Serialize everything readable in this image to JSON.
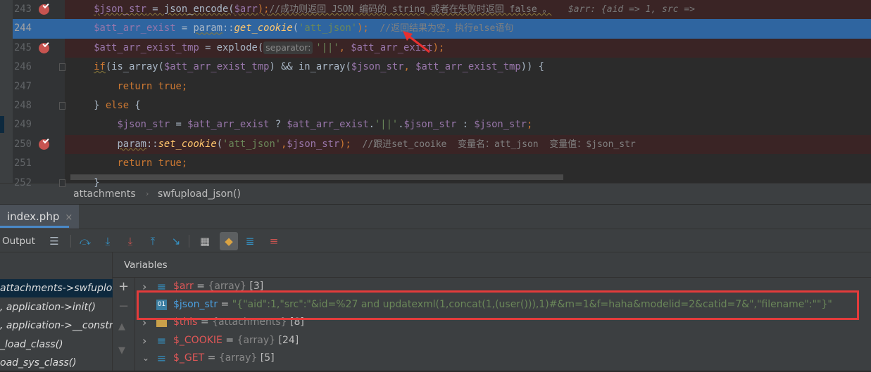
{
  "editor": {
    "lines": [
      {
        "num": "243",
        "bp": true,
        "fold": false,
        "state": "bp",
        "tokens": [
          [
            "    ",
            "d"
          ],
          [
            "$json_str",
            "v"
          ],
          [
            " = json_encode(",
            "d"
          ],
          [
            "$arr",
            "v"
          ],
          [
            ");",
            "p"
          ],
          [
            "//成功则返回 JSON 编码的 string 或者在失败时返回 false 。",
            "c"
          ],
          [
            "   $arr: {aid => 1, src =>",
            "hint"
          ]
        ]
      },
      {
        "num": "244",
        "bp": false,
        "fold": false,
        "state": "cur",
        "tokens": [
          [
            "    ",
            "d"
          ],
          [
            "$att_arr_exist",
            "v"
          ],
          [
            " = ",
            "d"
          ],
          [
            "param",
            "d"
          ],
          [
            "::",
            "d"
          ],
          [
            "get_cookie",
            "f"
          ],
          [
            "(",
            "d"
          ],
          [
            "'att_json'",
            "s"
          ],
          [
            ");",
            "p"
          ],
          [
            "  //返回结果为空，执行else语句",
            "c"
          ]
        ]
      },
      {
        "num": "245",
        "bp": true,
        "fold": false,
        "state": "bp",
        "tokens": [
          [
            "    ",
            "d"
          ],
          [
            "$att_arr_exist_tmp",
            "v"
          ],
          [
            " = explode(",
            "d"
          ],
          [
            "separator:",
            "param"
          ],
          [
            "'||'",
            "s"
          ],
          [
            ", ",
            "p"
          ],
          [
            "$att_arr_exist",
            "v"
          ],
          [
            ");",
            "p"
          ]
        ]
      },
      {
        "num": "246",
        "bp": false,
        "fold": true,
        "state": "",
        "tokens": [
          [
            "    ",
            "d"
          ],
          [
            "if",
            "k"
          ],
          [
            "(is_array(",
            "d"
          ],
          [
            "$att_arr_exist_tmp",
            "v"
          ],
          [
            ") && in_array(",
            "d"
          ],
          [
            "$json_str",
            "v"
          ],
          [
            ", ",
            "p"
          ],
          [
            "$att_arr_exist_tmp",
            "v"
          ],
          [
            ")) {",
            "d"
          ]
        ]
      },
      {
        "num": "247",
        "bp": false,
        "fold": false,
        "state": "",
        "tokens": [
          [
            "        ",
            "d"
          ],
          [
            "return true;",
            "k"
          ]
        ]
      },
      {
        "num": "248",
        "bp": false,
        "fold": true,
        "state": "",
        "tokens": [
          [
            "    ",
            "d"
          ],
          [
            "} ",
            "d"
          ],
          [
            "else",
            "k"
          ],
          [
            " {",
            "d"
          ]
        ]
      },
      {
        "num": "249",
        "bp": false,
        "fold": false,
        "state": "",
        "tokens": [
          [
            "        ",
            "d"
          ],
          [
            "$json_str",
            "v"
          ],
          [
            " = ",
            "d"
          ],
          [
            "$att_arr_exist",
            "v"
          ],
          [
            " ? ",
            "d"
          ],
          [
            "$att_arr_exist",
            "v"
          ],
          [
            ".",
            "d"
          ],
          [
            "'||'",
            "s"
          ],
          [
            ".",
            "d"
          ],
          [
            "$json_str",
            "v"
          ],
          [
            " : ",
            "d"
          ],
          [
            "$json_str",
            "v"
          ],
          [
            ";",
            "p"
          ]
        ]
      },
      {
        "num": "250",
        "bp": true,
        "fold": false,
        "state": "bp",
        "tokens": [
          [
            "        ",
            "d"
          ],
          [
            "param",
            "d"
          ],
          [
            "::",
            "d"
          ],
          [
            "set_cookie",
            "f"
          ],
          [
            "(",
            "d"
          ],
          [
            "'att_json'",
            "s"
          ],
          [
            ",",
            "p"
          ],
          [
            "$json_str",
            "v"
          ],
          [
            ");",
            "p"
          ],
          [
            "  //跟进set_cooike  变量名：att_json  变量值：$json_str",
            "c"
          ]
        ]
      },
      {
        "num": "251",
        "bp": false,
        "fold": false,
        "state": "",
        "tokens": [
          [
            "        ",
            "d"
          ],
          [
            "return true;",
            "k"
          ]
        ]
      },
      {
        "num": "252",
        "bp": false,
        "fold": true,
        "state": "",
        "tokens": [
          [
            "    ",
            "d"
          ],
          [
            "}",
            "d"
          ]
        ]
      }
    ]
  },
  "breadcrumb": {
    "items": [
      "attachments",
      "swfupload_json()"
    ],
    "separator": "›"
  },
  "tab": {
    "label": "index.php",
    "close": "×"
  },
  "toolbar": {
    "output_label": "Output",
    "buttons": [
      {
        "name": "layout-icon",
        "glyph": "☰",
        "color": "#aab4be"
      },
      {
        "name": "step-over-icon",
        "glyph": "⤼",
        "color": "#3592c4"
      },
      {
        "name": "step-into-icon",
        "glyph": "⤓",
        "color": "#3592c4"
      },
      {
        "name": "force-step-into-icon",
        "glyph": "⤓",
        "color": "#c75450"
      },
      {
        "name": "step-out-icon",
        "glyph": "⤒",
        "color": "#3592c4"
      },
      {
        "name": "run-to-cursor-icon",
        "glyph": "↘",
        "color": "#3592c4"
      },
      {
        "name": "evaluate-expression-icon",
        "glyph": "▦",
        "color": "#bbbbbb"
      },
      {
        "name": "constants-icon",
        "glyph": "◆",
        "color": "#d9a343"
      },
      {
        "name": "ordered-list-icon",
        "glyph": "≣",
        "color": "#3592c4"
      },
      {
        "name": "add-watch-icon",
        "glyph": "≡",
        "color": "#c75450"
      }
    ]
  },
  "frames": [
    "attachments->swfupload_json()",
    ", application->init()",
    ", application->__construct()",
    "_load_class()",
    "oad_sys_class()"
  ],
  "variables": {
    "header": "Variables",
    "rows": [
      {
        "expand": "›",
        "icon": "array",
        "name": "$arr",
        "eq": " = ",
        "type": "{array}",
        "count": " [3]"
      },
      {
        "expand": "",
        "icon": "01",
        "name": "$json_str",
        "eq": " = ",
        "value": "\"{\"aid\":1,\"src\":\"&id=%27 and updatexml(1,concat(1,(user())),1)#&m=1&f=haha&modelid=2&catid=7&\",\"filename\":\"\"}\""
      },
      {
        "expand": "›",
        "icon": "object",
        "name": "$this",
        "eq": " = ",
        "type": "{attachments}",
        "count": " [8]"
      },
      {
        "expand": "›",
        "icon": "array",
        "name": "$_COOKIE",
        "eq": " = ",
        "type": "{array}",
        "count": " [24]"
      },
      {
        "expand": "⌄",
        "icon": "array",
        "name": "$_GET",
        "eq": " = ",
        "type": "{array}",
        "count": " [5]"
      }
    ]
  },
  "colors": {
    "highlight": "#2f65a0",
    "breakpoint_line": "#3a2425",
    "annotation_box": "#e33b3b",
    "arrow": "#e83030"
  }
}
